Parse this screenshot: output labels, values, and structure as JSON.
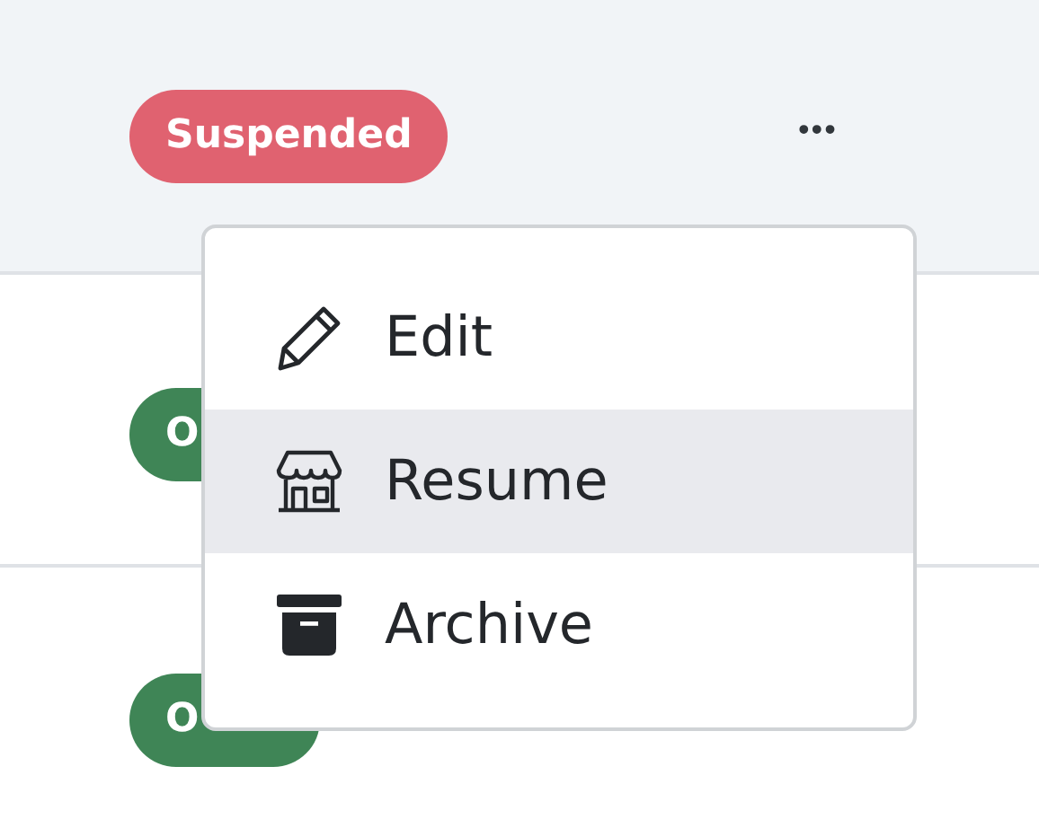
{
  "rows": [
    {
      "status": "Suspended",
      "color": "#e06270",
      "selected": true,
      "more": "•••"
    },
    {
      "status": "O",
      "color": "#3f8556",
      "selected": false
    },
    {
      "status": "O",
      "color": "#3f8556",
      "selected": false
    }
  ],
  "menu": {
    "items": [
      {
        "label": "Edit",
        "kind": "pencil",
        "selected": false
      },
      {
        "label": "Resume",
        "kind": "store",
        "selected": true
      },
      {
        "label": "Archive",
        "kind": "archive",
        "selected": false
      }
    ]
  }
}
